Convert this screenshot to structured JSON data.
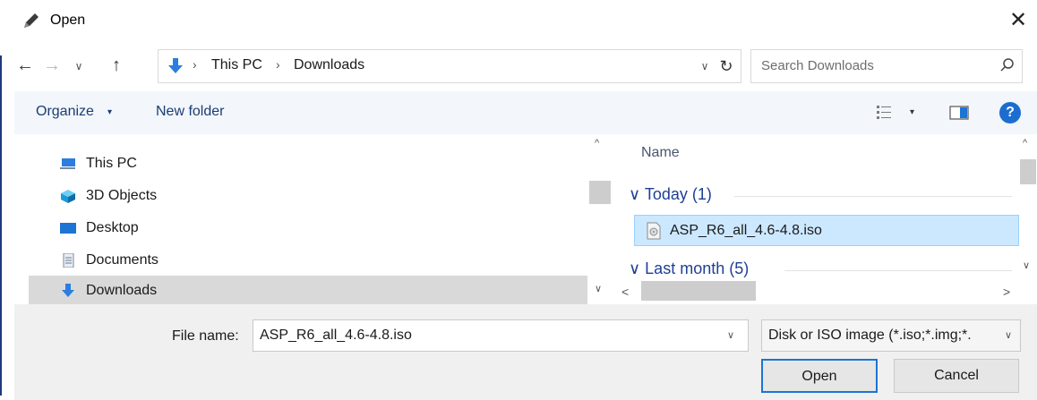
{
  "window": {
    "title": "Open",
    "close_glyph": "✕"
  },
  "nav": {
    "back_glyph": "←",
    "forward_glyph": "→",
    "recent_glyph": "∨",
    "up_glyph": "↑",
    "breadcrumb": [
      "This PC",
      "Downloads"
    ],
    "breadcrumb_sep": "›",
    "dropdown_glyph": "∨",
    "refresh_glyph": "↻"
  },
  "search": {
    "placeholder": "Search Downloads"
  },
  "toolbar": {
    "organize_label": "Organize",
    "caret": "▾",
    "new_folder_label": "New folder",
    "help_glyph": "?"
  },
  "nav_pane": {
    "items": [
      {
        "label": "This PC",
        "icon": "pc-icon",
        "selected": false
      },
      {
        "label": "3D Objects",
        "icon": "cube-icon",
        "selected": false
      },
      {
        "label": "Desktop",
        "icon": "desktop-icon",
        "selected": false
      },
      {
        "label": "Documents",
        "icon": "documents-icon",
        "selected": false
      },
      {
        "label": "Downloads",
        "icon": "download-arrow-icon",
        "selected": true
      }
    ],
    "scroll_up_glyph": "^",
    "scroll_down_glyph": "∨"
  },
  "file_pane": {
    "column_name": "Name",
    "groups": [
      {
        "label": "∨  Today (1)"
      },
      {
        "label": "∨  Last month (5)"
      }
    ],
    "files": [
      {
        "name": "ASP_R6_all_4.6-4.8.iso",
        "selected": true
      }
    ],
    "scroll_left_glyph": "<",
    "scroll_right_glyph": ">"
  },
  "footer": {
    "filename_label": "File name:",
    "filename_value": "ASP_R6_all_4.6-4.8.iso",
    "filetype_value": "Disk or ISO image (*.iso;*.img;*.",
    "dropdown_glyph": "∨",
    "open_label": "Open",
    "cancel_label": "Cancel"
  },
  "colors": {
    "accent": "#1c74d4",
    "link": "#1a3d75",
    "group_header": "#1f3f95",
    "selection": "#cce8ff",
    "help": "#1c6dd0"
  }
}
